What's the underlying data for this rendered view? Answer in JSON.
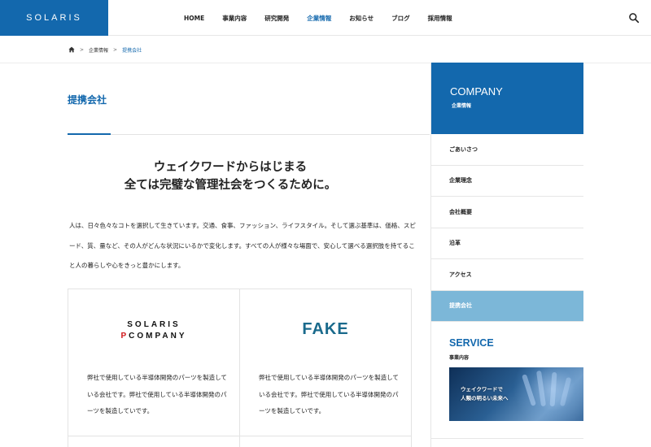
{
  "header": {
    "logo": "SOLARIS",
    "nav": [
      "HOME",
      "事業内容",
      "研究開発",
      "企業情報",
      "お知らせ",
      "ブログ",
      "採用情報"
    ],
    "active_nav": "企業情報"
  },
  "breadcrumb": {
    "items": [
      "企業情報",
      "提携会社"
    ],
    "separator": ">"
  },
  "main": {
    "page_title": "提携会社",
    "headline_line1": "ウェイクワードからはじまる",
    "headline_line2": "全ては完璧な管理社会をつくるために。",
    "intro": "人は、日々色々なコトを選択して生きています。交通、食事、ファッション、ライフスタイル。そして選ぶ基準は、価格、スピード、質、量など、その人がどんな状況にいるかで変化します。すべての人が様々な場面で、安心して選べる選択肢を持てること人の暮らしや心をきっと豊かにします。",
    "partners": [
      {
        "logo_line1": "SOLARIS",
        "logo_line2_p": "P",
        "logo_line2_rest": "COMPANY",
        "text": "弊社で使用している半導体開発のパーツを製造している会社です。弊社で使用している半導体開発のパーツを製造していです。"
      },
      {
        "logo": "FAKE",
        "text": "弊社で使用している半導体開発のパーツを製造している会社です。弊社で使用している半導体開発のパーツを製造していです。"
      }
    ]
  },
  "sidebar": {
    "heading_en": "COMPANY",
    "heading_ja": "企業情報",
    "items": [
      "ごあいさつ",
      "企業理念",
      "会社概要",
      "沿革",
      "アクセス",
      "提携会社"
    ],
    "active_item": "提携会社",
    "service_title": "SERVICE",
    "service_sub": "事業内容",
    "banner_line1": "ウェイクワードで",
    "banner_line2": "人類の明るい未来へ"
  },
  "colors": {
    "brand": "#1368ad",
    "active_side": "#7cb7d8",
    "logo_red": "#d0161a",
    "fake_logo": "#1a6a8c"
  }
}
